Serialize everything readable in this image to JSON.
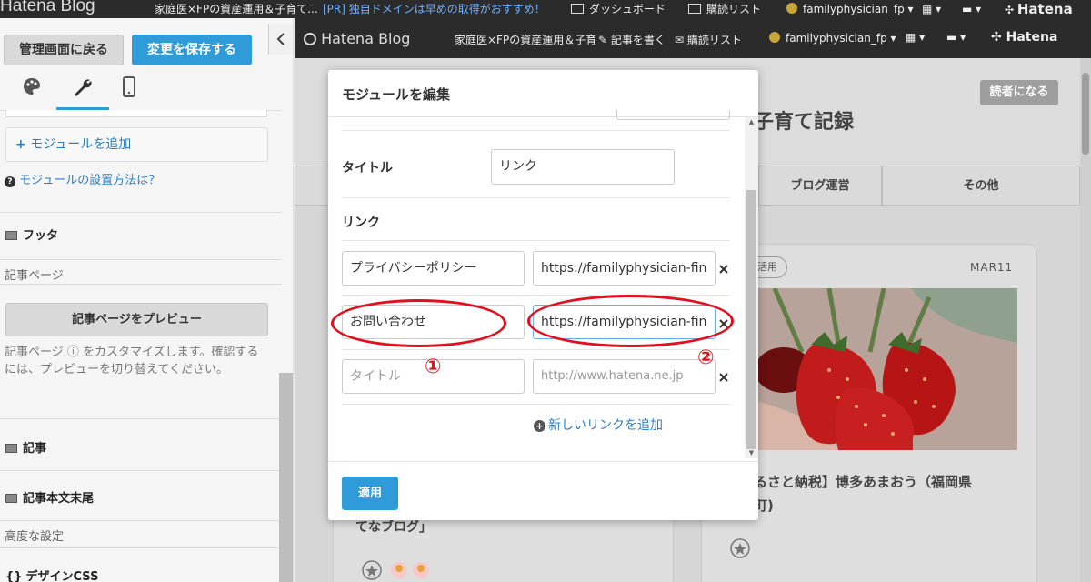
{
  "topbar": {
    "logo": "Hatena Blog",
    "blog_title": "家庭医×FPの資産運用＆子育て...",
    "promo": "[PR] 独自ドメインは早めの取得がおすすめ！",
    "dashboard": "ダッシュボード",
    "subscriptions": "購読リスト",
    "user": "familyphysician_fp",
    "brand": "Hatena"
  },
  "left_panel": {
    "back_button": "管理画面に戻る",
    "save_button": "変更を保存する",
    "tabs": [
      "design-tab",
      "customize-tab",
      "smartphone-tab"
    ],
    "add_module": "モジュールを追加",
    "module_help": "モジュールの設置方法は？",
    "footer_section": "フッタ",
    "article_page_label": "記事ページ",
    "preview_button": "記事ページをプレビュー",
    "preview_desc": "記事ページ ⓘ をカスタマイズします。確認するには、プレビューを切り替えてください。",
    "article_section": "記事",
    "article_end_section": "記事本文末尾",
    "advanced_label": "高度な設定",
    "design_css_icon": "{}",
    "design_css": "デザインCSS"
  },
  "preview": {
    "logo": "Hatena Blog",
    "blog_title": "家庭医×FPの資産運用＆子育て記録",
    "write_article": "記事を書く",
    "subscriptions": "購読リスト",
    "user": "familyphysician_fp",
    "brand": "Hatena",
    "subscribe_button": "読者になる",
    "heading_partial": "子育て記録",
    "nav": [
      "ブログ運営",
      "その他"
    ],
    "card_tag": "活用",
    "card_date": "MAR11",
    "card_title": "るさと納税】博多あまおう（福岡県",
    "card_title_2": "町)",
    "left_card_text": "てなブログ」"
  },
  "modal": {
    "title": "モジュールを編集",
    "title_label": "タイトル",
    "title_value": "リンク",
    "links_label": "リンク",
    "links": [
      {
        "title": "プライバシーポリシー",
        "url": "https://familyphysician-fin"
      },
      {
        "title": "お問い合わせ",
        "url": "https://familyphysician-fin"
      }
    ],
    "new_link": {
      "title_placeholder": "タイトル",
      "url_placeholder": "http://www.hatena.ne.jp"
    },
    "add_link": "新しいリンクを追加",
    "apply_button": "適用"
  },
  "annotations": {
    "marker_1": "①",
    "marker_2": "②",
    "color": "#e0101e"
  }
}
